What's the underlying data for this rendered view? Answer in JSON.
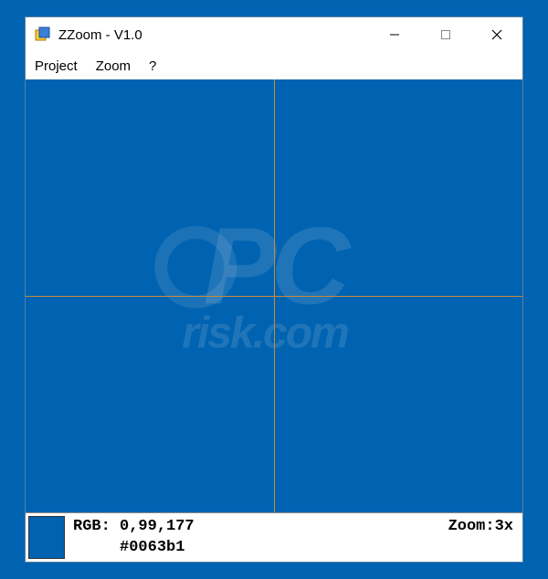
{
  "window": {
    "title": "ZZoom - V1.0"
  },
  "menu": {
    "project": "Project",
    "zoom": "Zoom",
    "help": "?"
  },
  "status": {
    "rgb_label": "RGB:",
    "rgb_value": "0,99,177",
    "hex_value": "#0063b1",
    "zoom_label": "Zoom:",
    "zoom_value": "3x",
    "swatch_color": "#0063b1"
  }
}
